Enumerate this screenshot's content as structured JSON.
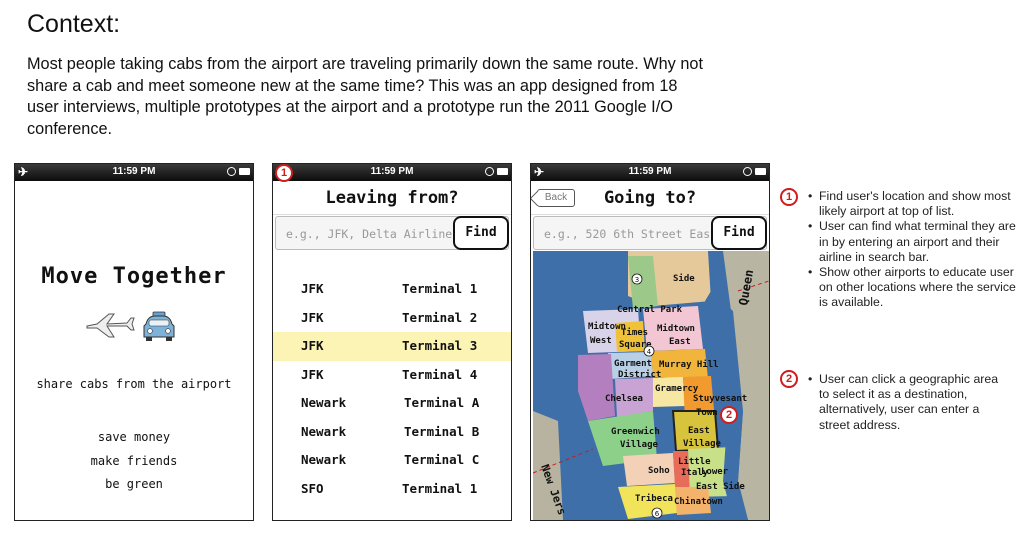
{
  "context": {
    "title": "Context:",
    "body": "Most people taking cabs from the airport are traveling primarily down the same route. Why not share a cab and meet someone new at the same time? This was an app designed from 18 user interviews, multiple prototypes at the airport and a prototype run the 2011 Google I/O conference."
  },
  "status_time": "11:59 PM",
  "screen1": {
    "title": "Move Together",
    "tagline": "share cabs from the airport",
    "lines": [
      "save money",
      "make friends",
      "be green"
    ]
  },
  "screen2": {
    "badge": "1",
    "header": "Leaving from?",
    "placeholder": "e.g., JFK, Delta Airlines",
    "find_label": "Find",
    "rows": [
      {
        "airport": "JFK",
        "terminal": "Terminal 1"
      },
      {
        "airport": "JFK",
        "terminal": "Terminal 2"
      },
      {
        "airport": "JFK",
        "terminal": "Terminal 3",
        "selected": true
      },
      {
        "airport": "JFK",
        "terminal": "Terminal 4"
      },
      {
        "airport": "Newark",
        "terminal": "Terminal A"
      },
      {
        "airport": "Newark",
        "terminal": "Terminal B"
      },
      {
        "airport": "Newark",
        "terminal": "Terminal C"
      },
      {
        "airport": "SFO",
        "terminal": "Terminal 1"
      }
    ]
  },
  "screen3": {
    "back_label": "Back",
    "header": "Going to?",
    "placeholder": "e.g., 520 6th Street East",
    "find_label": "Find",
    "map_labels": {
      "side": "Side",
      "central_park": "Central Park",
      "queens": "Queen",
      "midtown_west_1": "Midtown",
      "midtown_west_2": "West",
      "times_1": "Times",
      "times_2": "Square",
      "midtown_east_1": "Midtown",
      "midtown_east_2": "East",
      "garment_1": "Garment",
      "garment_2": "District",
      "murray_hill": "Murray Hill",
      "gramercy": "Gramercy",
      "chelsea": "Chelsea",
      "stuy_1": "Stuyvesant",
      "stuy_2": "Town",
      "east_village_1": "East",
      "east_village_2": "Village",
      "greenwich_1": "Greenwich",
      "greenwich_2": "Village",
      "soho": "Soho",
      "little_italy_1": "Little",
      "little_italy_2": "Italy",
      "les_1": "Lower",
      "les_2": "East Side",
      "tribeca": "Tribeca",
      "chinatown": "Chinatown",
      "new_jersey": "New Jers",
      "shield_3": "3",
      "shield_4": "4",
      "shield_6": "6"
    },
    "badge": "2"
  },
  "notes": [
    {
      "badge": "1",
      "items": [
        "Find user's location and show most likely airport at top of list.",
        "User can find what terminal they are in by entering an airport and their airline in search bar.",
        "Show other airports to educate user on other locations where the service is available."
      ]
    },
    {
      "badge": "2",
      "items": [
        "User can click a geographic area to select it as a destination, alternatively, user can enter a street address."
      ]
    }
  ],
  "colors": {
    "badge_red": "#d01c1c",
    "selected_row": "#fbf4b4",
    "water": "#3f6fa8",
    "status_bar": "#111111"
  }
}
